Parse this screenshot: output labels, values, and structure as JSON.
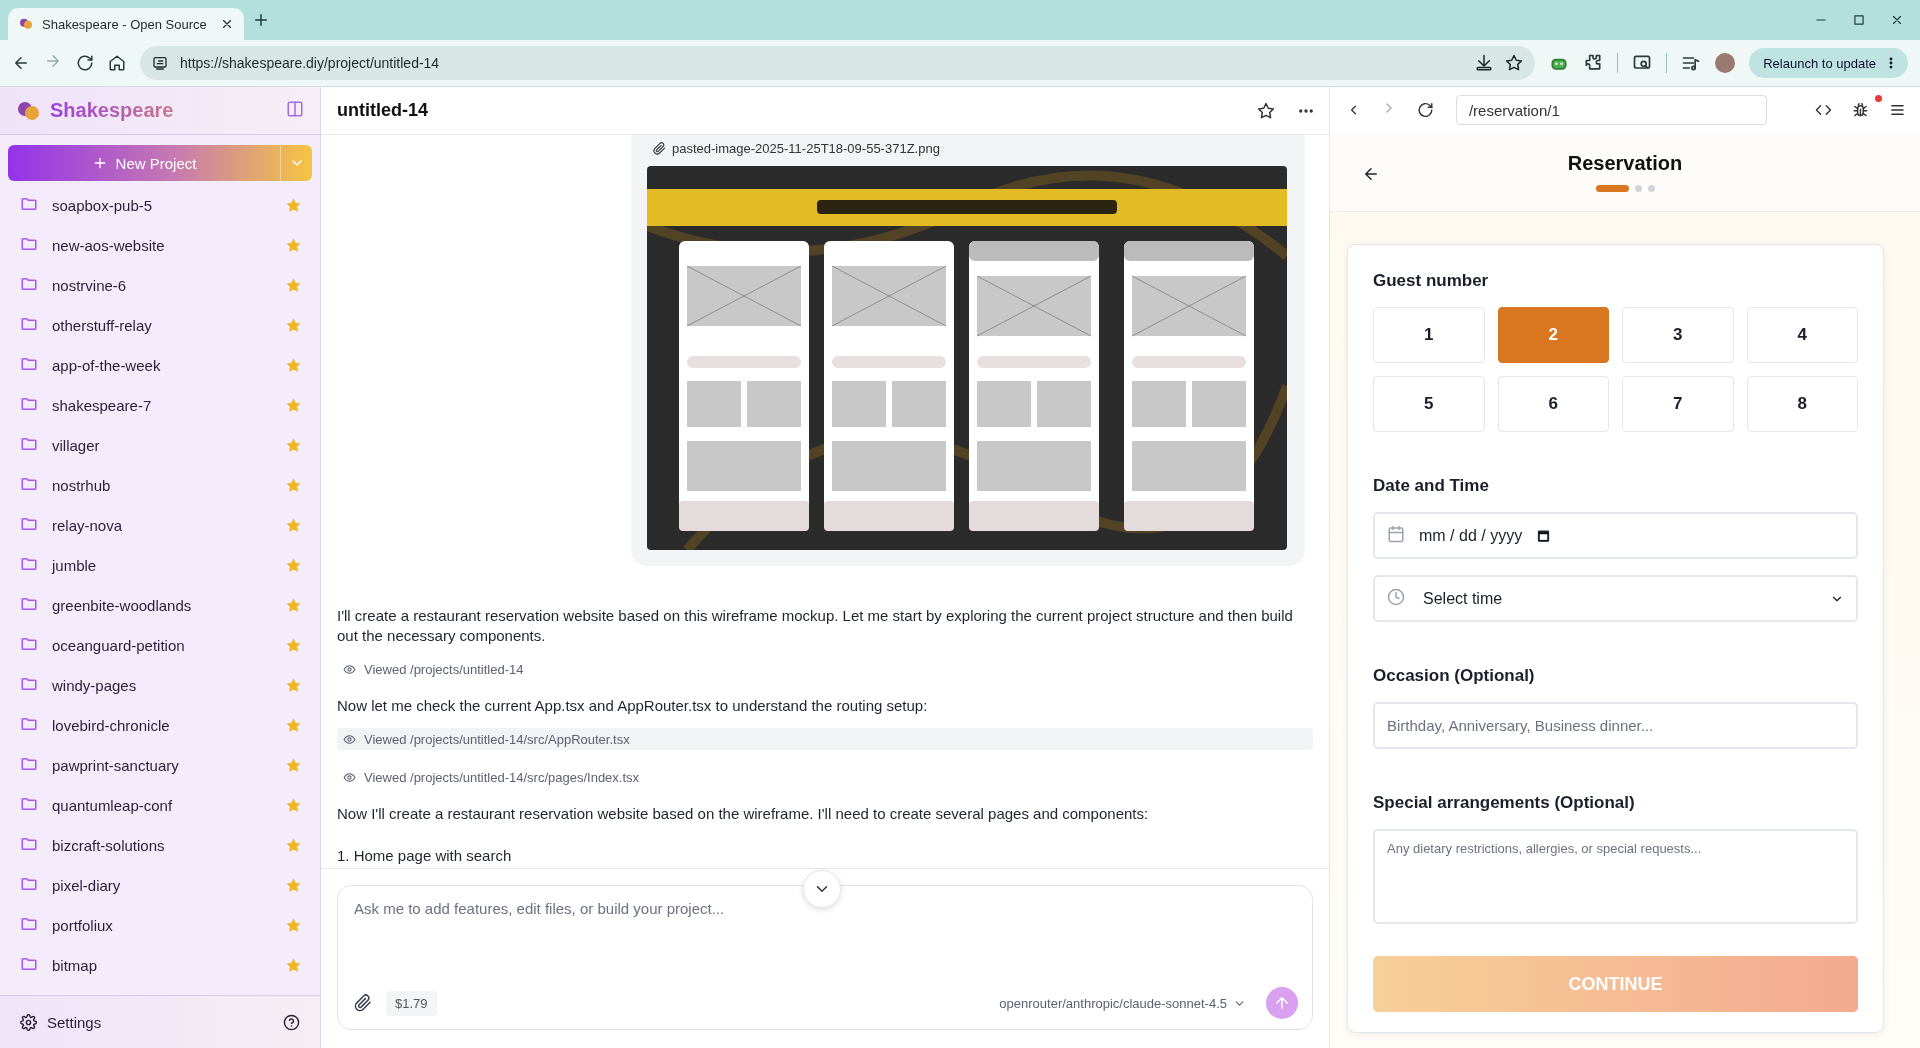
{
  "browser": {
    "tab_title": "Shakespeare - Open Source",
    "url": "https://shakespeare.diy/project/untitled-14",
    "relaunch_button": "Relaunch to update"
  },
  "sidebar": {
    "brand": "Shakespeare",
    "new_project": "New Project",
    "projects": [
      {
        "name": "soapbox-pub-5",
        "starred": true
      },
      {
        "name": "new-aos-website",
        "starred": true
      },
      {
        "name": "nostrvine-6",
        "starred": true
      },
      {
        "name": "otherstuff-relay",
        "starred": true
      },
      {
        "name": "app-of-the-week",
        "starred": true
      },
      {
        "name": "shakespeare-7",
        "starred": true
      },
      {
        "name": "villager",
        "starred": true
      },
      {
        "name": "nostrhub",
        "starred": true
      },
      {
        "name": "relay-nova",
        "starred": true
      },
      {
        "name": "jumble",
        "starred": true
      },
      {
        "name": "greenbite-woodlands",
        "starred": true
      },
      {
        "name": "oceanguard-petition",
        "starred": true
      },
      {
        "name": "windy-pages",
        "starred": true
      },
      {
        "name": "lovebird-chronicle",
        "starred": true
      },
      {
        "name": "pawprint-sanctuary",
        "starred": true
      },
      {
        "name": "quantumleap-conf",
        "starred": true
      },
      {
        "name": "bizcraft-solutions",
        "starred": true
      },
      {
        "name": "pixel-diary",
        "starred": true
      },
      {
        "name": "portfoliux",
        "starred": true
      },
      {
        "name": "bitmap",
        "starred": true
      }
    ],
    "settings": "Settings"
  },
  "chat": {
    "title": "untitled-14",
    "attachment": "pasted-image-2025-11-25T18-09-55-371Z.png",
    "messages": [
      {
        "kind": "text",
        "text": "I'll create a restaurant reservation website based on this wireframe mockup. Let me start by exploring the current project structure and then build out the necessary components."
      },
      {
        "kind": "tool",
        "text": "Viewed /projects/untitled-14",
        "highlighted": false
      },
      {
        "kind": "text",
        "text": "Now let me check the current App.tsx and AppRouter.tsx to understand the routing setup:"
      },
      {
        "kind": "tool",
        "text": "Viewed /projects/untitled-14/src/AppRouter.tsx",
        "highlighted": true
      },
      {
        "kind": "tool",
        "text": "Viewed /projects/untitled-14/src/pages/Index.tsx",
        "highlighted": false
      },
      {
        "kind": "text",
        "text": "Now I'll create a restaurant reservation website based on the wireframe. I'll need to create several pages and components:"
      },
      {
        "kind": "text",
        "text": "1. Home page with search"
      }
    ],
    "input": {
      "placeholder": "Ask me to add features, edit files, or build your project..."
    },
    "cost": "$1.79",
    "model": "openrouter/anthropic/claude-sonnet-4.5"
  },
  "preview": {
    "path": "/reservation/1",
    "title": "Reservation",
    "steps": [
      {
        "selected": true
      },
      {
        "selected": false
      },
      {
        "selected": false
      }
    ],
    "guest_label": "Guest number",
    "guests": [
      {
        "label": "1",
        "selected": false
      },
      {
        "label": "2",
        "selected": true
      },
      {
        "label": "3",
        "selected": false
      },
      {
        "label": "4",
        "selected": false
      },
      {
        "label": "5",
        "selected": false
      },
      {
        "label": "6",
        "selected": false
      },
      {
        "label": "7",
        "selected": false
      },
      {
        "label": "8",
        "selected": false
      }
    ],
    "date_label": "Date and Time",
    "date_placeholder": "mm / dd / yyyy",
    "time_value": "Select time",
    "occasion_label": "Occasion (Optional)",
    "occasion_placeholder": "Birthday, Anniversary, Business dinner...",
    "special_label": "Special arrangements (Optional)",
    "special_placeholder": "Any dietary restrictions, allergies, or special requests...",
    "continue_button": "CONTINUE"
  }
}
